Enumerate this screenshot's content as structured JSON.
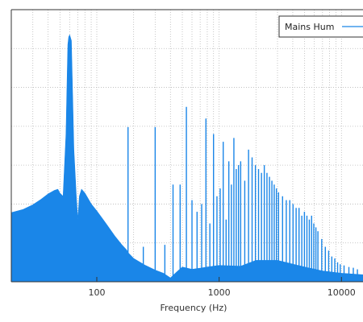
{
  "chart_data": {
    "type": "area",
    "xlabel": "Frequency (Hz)",
    "ylabel": "",
    "x_scale": "log",
    "xlim": [
      20,
      15000
    ],
    "ylim": [
      0,
      7
    ],
    "x_ticks": [
      100,
      1000,
      10000
    ],
    "x_tick_labels": [
      "100",
      "1000",
      "10000"
    ],
    "y_ticks": [
      0,
      1,
      2,
      3,
      4,
      5,
      6,
      7
    ],
    "grid": true,
    "legend_position": "top-right",
    "series": [
      {
        "name": "Mains Hum",
        "color": "#1a86e8",
        "envelope": [
          [
            20,
            1.78
          ],
          [
            25,
            1.86
          ],
          [
            30,
            1.98
          ],
          [
            35,
            2.12
          ],
          [
            40,
            2.26
          ],
          [
            45,
            2.35
          ],
          [
            48,
            2.38
          ],
          [
            50,
            2.28
          ],
          [
            53,
            2.2
          ],
          [
            56,
            3.8
          ],
          [
            58,
            6.1
          ],
          [
            59,
            6.3
          ],
          [
            60,
            6.35
          ],
          [
            61,
            6.28
          ],
          [
            62,
            6.2
          ],
          [
            63,
            5.2
          ],
          [
            65,
            3.4
          ],
          [
            68,
            2.2
          ],
          [
            70,
            1.6
          ],
          [
            72,
            2.2
          ],
          [
            75,
            2.38
          ],
          [
            80,
            2.28
          ],
          [
            90,
            2.0
          ],
          [
            100,
            1.82
          ],
          [
            120,
            1.48
          ],
          [
            140,
            1.18
          ],
          [
            160,
            0.95
          ],
          [
            175,
            0.82
          ],
          [
            180,
            0.75
          ],
          [
            200,
            0.6
          ],
          [
            250,
            0.42
          ],
          [
            300,
            0.3
          ],
          [
            350,
            0.22
          ],
          [
            400,
            0.1
          ],
          [
            450,
            0.25
          ],
          [
            500,
            0.38
          ],
          [
            600,
            0.32
          ],
          [
            800,
            0.38
          ],
          [
            1000,
            0.42
          ],
          [
            1500,
            0.4
          ],
          [
            2000,
            0.55
          ],
          [
            3000,
            0.55
          ],
          [
            5000,
            0.38
          ],
          [
            7000,
            0.28
          ],
          [
            10000,
            0.22
          ],
          [
            15000,
            0.18
          ]
        ],
        "peaks": [
          [
            180,
            3.98
          ],
          [
            240,
            0.9
          ],
          [
            300,
            3.98
          ],
          [
            360,
            0.95
          ],
          [
            420,
            2.5
          ],
          [
            480,
            2.5
          ],
          [
            540,
            4.5
          ],
          [
            600,
            2.1
          ],
          [
            660,
            1.8
          ],
          [
            720,
            2.0
          ],
          [
            780,
            4.2
          ],
          [
            840,
            1.5
          ],
          [
            900,
            3.8
          ],
          [
            960,
            2.2
          ],
          [
            1020,
            2.4
          ],
          [
            1080,
            3.6
          ],
          [
            1140,
            1.6
          ],
          [
            1200,
            3.1
          ],
          [
            1260,
            2.5
          ],
          [
            1320,
            3.7
          ],
          [
            1380,
            2.9
          ],
          [
            1440,
            3.0
          ],
          [
            1500,
            3.1
          ],
          [
            1620,
            2.6
          ],
          [
            1740,
            3.4
          ],
          [
            1860,
            3.2
          ],
          [
            1980,
            3.0
          ],
          [
            2100,
            2.9
          ],
          [
            2220,
            2.8
          ],
          [
            2340,
            3.0
          ],
          [
            2460,
            2.8
          ],
          [
            2580,
            2.7
          ],
          [
            2700,
            2.6
          ],
          [
            2820,
            2.5
          ],
          [
            2940,
            2.4
          ],
          [
            3060,
            2.3
          ],
          [
            3300,
            2.2
          ],
          [
            3540,
            2.1
          ],
          [
            3780,
            2.1
          ],
          [
            4020,
            2.0
          ],
          [
            4260,
            1.9
          ],
          [
            4500,
            1.9
          ],
          [
            4740,
            1.7
          ],
          [
            4980,
            1.8
          ],
          [
            5220,
            1.7
          ],
          [
            5460,
            1.6
          ],
          [
            5700,
            1.7
          ],
          [
            5940,
            1.5
          ],
          [
            6180,
            1.4
          ],
          [
            6420,
            1.3
          ],
          [
            6900,
            1.1
          ],
          [
            7380,
            0.9
          ],
          [
            7860,
            0.8
          ],
          [
            8340,
            0.65
          ],
          [
            8820,
            0.6
          ],
          [
            9300,
            0.5
          ],
          [
            9780,
            0.45
          ],
          [
            10500,
            0.42
          ],
          [
            11500,
            0.38
          ],
          [
            12500,
            0.36
          ],
          [
            13500,
            0.32
          ]
        ]
      }
    ]
  }
}
